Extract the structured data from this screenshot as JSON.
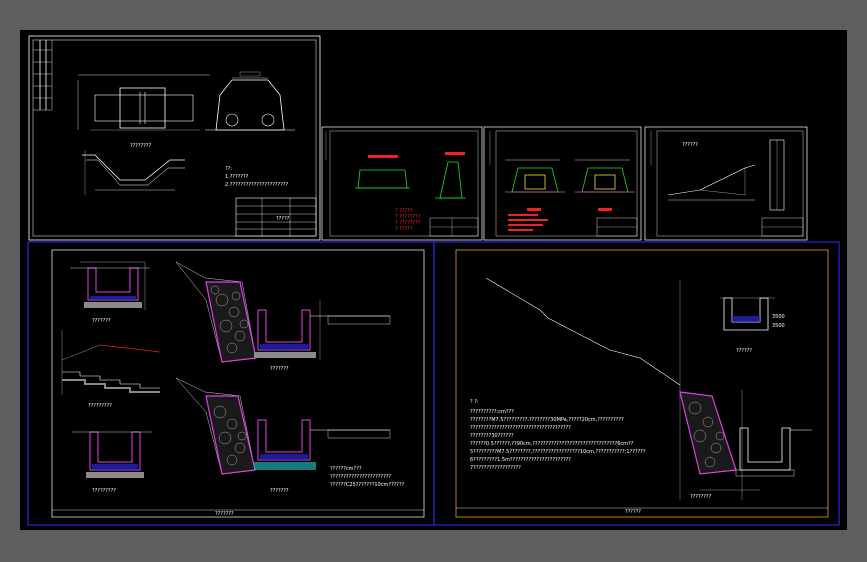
{
  "canvas": {
    "background": "#000000",
    "frame": "#5e5e5e"
  },
  "colors": {
    "white": "#ffffff",
    "blue_frame": "#2a2ad0",
    "orange_frame": "#d08a2a",
    "magenta": "#e040e0",
    "green": "#22dd22",
    "red": "#ee2222",
    "yellow": "#e8e820",
    "cyan": "#20d0d0",
    "gray_fill": "#8a8a8a"
  },
  "labels": {
    "sheet_bl_caption": "???????",
    "sheet_br_caption": "??????",
    "drain_section_bl": "???????",
    "drain_section_bl2": "?????????",
    "section_bl_bottom": "?????????",
    "detail_br_title": "??????",
    "wall_caption_br": "????????",
    "dims": [
      "250",
      "200",
      "100",
      "300",
      "350",
      "500",
      "1:1.5",
      "150",
      "1:0.5"
    ],
    "br_scale_1": "3500",
    "br_scale_2": "3500"
  },
  "notes_br": [
    "? ?:",
    "??????????:cm???",
    "????????M7.5?????????,????????30MPa,?????20cm,??????????",
    "??????????????????????????????????????",
    "????????30??????",
    "??????0.5??????,??90cm,????????????????????????????????6cm??",
    "5?????????M7.5????????,??????????????????10cm,???????????;1??????",
    "6?????????1.5m???????????????????????",
    "7??????????????????"
  ],
  "notes_bl": [
    "??????cm???",
    "???????????????????????",
    "??????C25???????10cm??????"
  ],
  "notes_top_left": [
    "??:",
    "1.???????",
    "2.??????????????????????"
  ],
  "notes_green_sheet": [
    "? ?????",
    "? ????????",
    "? ????????",
    "? ?????"
  ],
  "title_tags": {
    "sheet1": "?????",
    "sheet4": "??????"
  }
}
